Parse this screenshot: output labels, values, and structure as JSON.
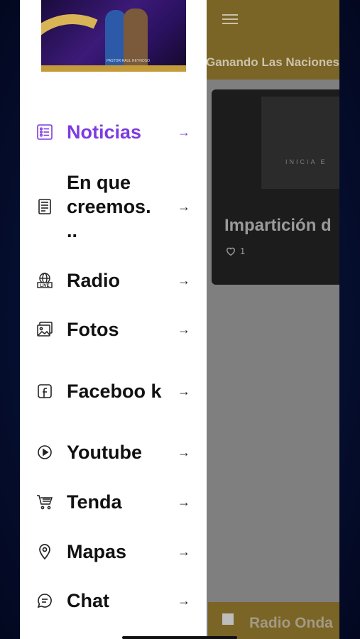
{
  "header": {
    "title": "Ganando Las Naciones"
  },
  "card": {
    "title": "Impartición d",
    "likes": "1",
    "screen_text": "INICIA E"
  },
  "player": {
    "station": "Radio Onda"
  },
  "banner": {
    "caption": "PASTOR RAUL REYNOSO"
  },
  "menu": [
    {
      "label": "Noticias",
      "icon": "news-list-icon",
      "active": true
    },
    {
      "label": "En que creemos. ..",
      "icon": "document-icon",
      "active": false
    },
    {
      "label": "Radio",
      "icon": "live-radio-icon",
      "active": false
    },
    {
      "label": "Fotos",
      "icon": "photos-icon",
      "active": false
    },
    {
      "label": "Faceboo k",
      "icon": "facebook-icon",
      "active": false
    },
    {
      "label": "Youtube",
      "icon": "play-circle-icon",
      "active": false
    },
    {
      "label": "Tenda",
      "icon": "cart-icon",
      "active": false
    },
    {
      "label": "Mapas",
      "icon": "map-pin-icon",
      "active": false
    },
    {
      "label": "Chat",
      "icon": "chat-icon",
      "active": false
    }
  ],
  "colors": {
    "accent": "#7d3be0",
    "header": "#7a6426"
  }
}
